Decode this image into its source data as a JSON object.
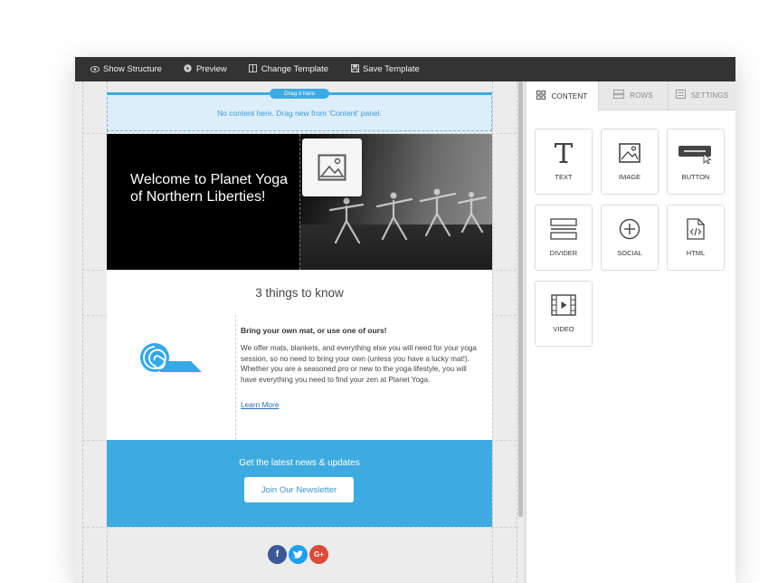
{
  "toolbar": {
    "show_structure": "Show Structure",
    "preview": "Preview",
    "change_template": "Change Template",
    "save_template": "Save Template"
  },
  "editor": {
    "drag_pill": "Drag it here",
    "drop_text": "No content here. Drag new from 'Content' panel.",
    "hero_title": "Welcome to Planet Yoga of Northern Liberties!",
    "section_title": "3 things to know",
    "content_heading": "Bring your own mat, or use one of ours!",
    "content_body": "We offer mats, blankets, and everything else you will need for your yoga session, so no need to bring your own (unless you have a lucky mat!). Whether you are a seasoned pro or new to the yoga lifestyle, you will have everything you need to find your zen at Planet Yoga.",
    "learn_more": "Learn More",
    "news_text": "Get the latest news & updates",
    "newsletter_button": "Join Our Newsletter",
    "social": [
      {
        "name": "facebook-icon",
        "glyph": "f",
        "color": "#3b5998"
      },
      {
        "name": "twitter-icon",
        "glyph": "t",
        "color": "#1da1f2"
      },
      {
        "name": "google-plus-icon",
        "glyph": "G+",
        "color": "#dd4b39"
      }
    ]
  },
  "panel": {
    "tabs": [
      {
        "label": "CONTENT",
        "active": true
      },
      {
        "label": "ROWS",
        "active": false
      },
      {
        "label": "SETTINGS",
        "active": false
      }
    ],
    "blocks": [
      {
        "label": "TEXT",
        "icon": "text-icon"
      },
      {
        "label": "IMAGE",
        "icon": "image-icon"
      },
      {
        "label": "BUTTON",
        "icon": "button-icon"
      },
      {
        "label": "DIVIDER",
        "icon": "divider-icon"
      },
      {
        "label": "SOCIAL",
        "icon": "social-icon"
      },
      {
        "label": "HTML",
        "icon": "html-icon"
      },
      {
        "label": "VIDEO",
        "icon": "video-icon"
      }
    ]
  },
  "colors": {
    "accent": "#3eabe0",
    "toolbar": "#333333",
    "link": "#2b69b3"
  }
}
